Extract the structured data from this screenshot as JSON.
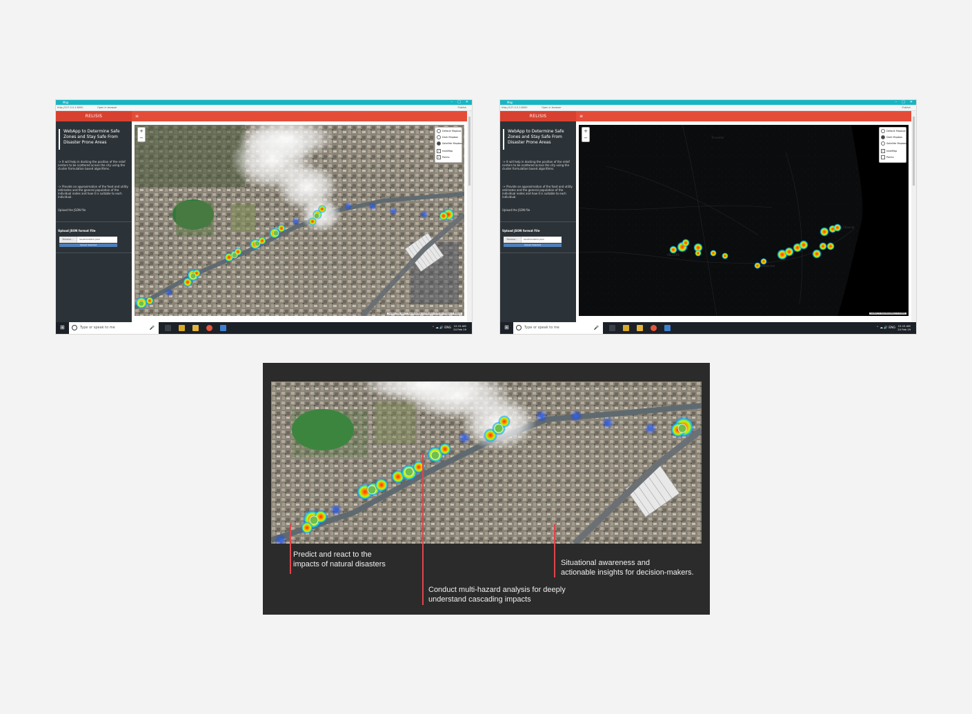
{
  "windows": [
    {
      "id": "left",
      "title": "Map",
      "address_url": "http://127.0.0.1:8000",
      "address_extra": "Open in browser",
      "publish_label": "Publish",
      "brand": "RELISIS",
      "menu_glyph": "≡",
      "sidebar": {
        "heading": "WebApp to Determine Safe Zones and Stay Safe From Disaster Prone Areas",
        "para1": "-> It will help in docking the position of the relief centers to be scattered across the city using the cluster formulation based algorithms.",
        "para2": "-> Provide an approximation of the food and utility estimates and the general population of the individual nodes and how it is suitable to each individual.",
        "upload_hint": "Upload the JSON file",
        "upload_title": "Upload JSON format File",
        "browse_label": "Browse...",
        "file_name": "locationdata.json",
        "upload_button": "Upload Selected"
      },
      "map": {
        "style": "satellite",
        "layer_options": [
          "Default Mapbox",
          "Dark Mapbox",
          "Satellite Mapbox"
        ],
        "selected_layer": "Satellite Mapbox",
        "overlays": [
          {
            "label": "heatMap",
            "checked": true
          },
          {
            "label": "Points",
            "checked": true
          }
        ],
        "attribution": "Leaflet | Map data © OpenStreetMap contributors, CC-BY-SA, Imagery © Mapbox"
      },
      "taskbar": {
        "search_placeholder": "Type or speak to me",
        "time": "12:15 AM",
        "date": "24 Feb 19",
        "tray": "⌃ ☁ 🔊 ENG"
      }
    },
    {
      "id": "right",
      "title": "Map",
      "address_url": "http://127.0.0.1:8000",
      "address_extra": "Open in browser",
      "publish_label": "Publish",
      "brand": "RELISIS",
      "menu_glyph": "≡",
      "sidebar": {
        "heading": "WebApp to Determine Safe Zones and Stay Safe From Disaster Prone Areas",
        "para1": "-> It will help in docking the position of the relief centers to be scattered across the city using the cluster formulation based algorithms.",
        "para2": "-> Provide an approximation of the food and utility estimates and the general population of the individual nodes and how it is suitable to each individual.",
        "upload_hint": "Upload the JSON file",
        "upload_title": "Upload JSON format File",
        "browse_label": "Browse...",
        "file_name": "locationdata.json",
        "upload_button": "Upload Selected"
      },
      "map": {
        "style": "dark",
        "layer_options": [
          "Default Mapbox",
          "Dark Mapbox",
          "Satellite Mapbox"
        ],
        "selected_layer": "Dark Mapbox",
        "overlays": [
          {
            "label": "heatMap",
            "checked": true
          },
          {
            "label": "Points",
            "checked": false
          }
        ],
        "attribution": "Leaflet | © OpenStreetMap | © CARTO",
        "place_labels": [
          "VELLORE",
          "Tiruvallur",
          "Chennai",
          "Kanchipuram"
        ]
      },
      "taskbar": {
        "search_placeholder": "Type or speak to me",
        "time": "12:15 AM",
        "date": "24 Feb 19",
        "tray": "⌃ ☁ 🔊 ENG"
      }
    }
  ],
  "zoom": {
    "in": "+",
    "out": "−"
  },
  "feature": {
    "callouts": [
      {
        "id": "predict",
        "text_line1": "Predict and react to the",
        "text_line2": "impacts of natural disasters"
      },
      {
        "id": "multi",
        "text_line1": "Conduct multi-hazard analysis for deeply",
        "text_line2": "understand cascading impacts"
      },
      {
        "id": "situational",
        "text_line1": "Situational awareness and",
        "text_line2": "actionable insights for decision-makers."
      }
    ],
    "accent_color": "#e0454a"
  },
  "colors": {
    "header_red": "#e54c38",
    "titlebar_teal": "#17b5c3",
    "sidebar_dark": "#2c3338",
    "taskbar": "#1c2128"
  }
}
